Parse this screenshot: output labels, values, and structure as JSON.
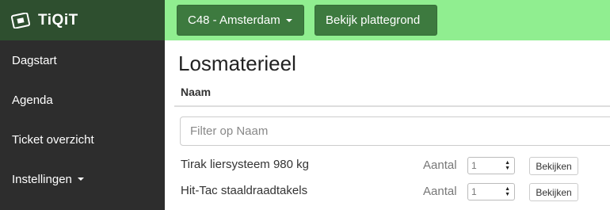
{
  "app": {
    "name": "TiQiT",
    "icon": "ticket-icon"
  },
  "sidebar": {
    "items": [
      {
        "label": "Dagstart"
      },
      {
        "label": "Agenda"
      },
      {
        "label": "Ticket overzicht"
      },
      {
        "label": "Instellingen",
        "has_dropdown": true
      }
    ]
  },
  "topbar": {
    "location_label": "C48 - Amsterdam",
    "map_button_label": "Bekijk plattegrond"
  },
  "main": {
    "title": "Losmaterieel",
    "column_header": "Naam",
    "filter_placeholder": "Filter op Naam",
    "rows": [
      {
        "name": "Tirak liersysteem 980 kg",
        "qty_label": "Aantal",
        "qty": "1",
        "button": "Bekijken"
      },
      {
        "name": "Hit-Tac staaldraadtakels",
        "qty_label": "Aantal",
        "qty": "1",
        "button": "Bekijken"
      }
    ]
  },
  "colors": {
    "sidebar_bg": "#2d2d2d",
    "brand_bg": "#2e4f2f",
    "topbar_bg": "#90ee90",
    "button_bg": "#3d7a3f"
  }
}
